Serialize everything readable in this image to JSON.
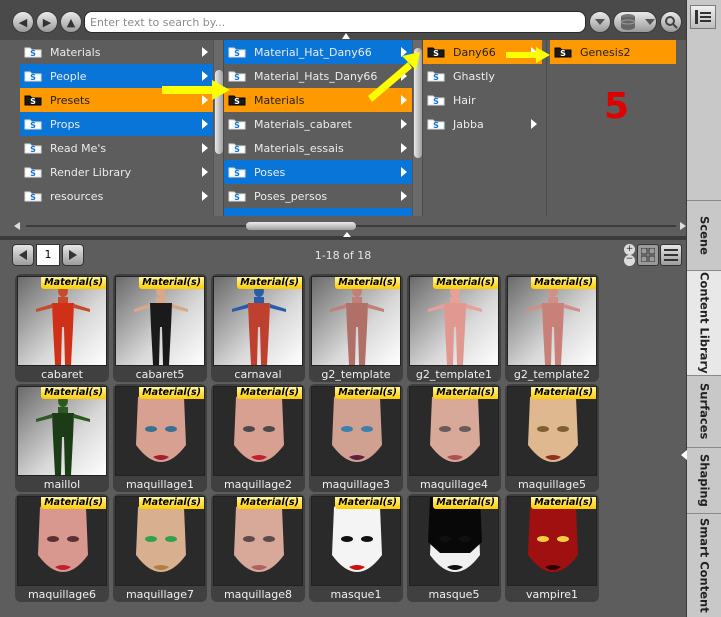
{
  "toolbar": {
    "back_label": "◀",
    "forward_label": "▶",
    "up_label": "▲",
    "search_placeholder": "Enter text to search by..."
  },
  "browser": {
    "column1": [
      {
        "label": "Materials",
        "state": "none"
      },
      {
        "label": "People",
        "state": "blue"
      },
      {
        "label": "Presets",
        "state": "orange"
      },
      {
        "label": "Props",
        "state": "blue"
      },
      {
        "label": "Read Me's",
        "state": "none"
      },
      {
        "label": "Render Library",
        "state": "none"
      },
      {
        "label": "resources",
        "state": "none"
      }
    ],
    "column2": [
      {
        "label": "Material_Hat_Dany66",
        "state": "blue"
      },
      {
        "label": "Material_Hats_Dany66",
        "state": "none"
      },
      {
        "label": "Materials",
        "state": "orange"
      },
      {
        "label": "Materials_cabaret",
        "state": "none"
      },
      {
        "label": "Materials_essais",
        "state": "none"
      },
      {
        "label": "Poses",
        "state": "blue"
      },
      {
        "label": "Poses_persos",
        "state": "none"
      }
    ],
    "column3": [
      {
        "label": "Dany66",
        "state": "orange"
      },
      {
        "label": "Ghastly",
        "state": "none"
      },
      {
        "label": "Hair",
        "state": "none"
      },
      {
        "label": "Jabba",
        "state": "none"
      }
    ],
    "column4": [
      {
        "label": "Genesis2",
        "state": "orange"
      }
    ]
  },
  "annotation_number": "5",
  "pager": {
    "page": "1",
    "count_text": "1-18 of 18"
  },
  "badge_text": "Material(s)",
  "tiles": [
    {
      "caption": "cabaret",
      "kind": "body",
      "skin": "#c84a2c",
      "outfit": "#d03018"
    },
    {
      "caption": "cabaret5",
      "kind": "body",
      "skin": "#d9a888",
      "outfit": "#1a1a1a"
    },
    {
      "caption": "carnaval",
      "kind": "body",
      "skin": "#2a5da8",
      "outfit": "#c04030"
    },
    {
      "caption": "g2_template",
      "kind": "body",
      "skin": "#c08078",
      "outfit": "#b07068"
    },
    {
      "caption": "g2_template1",
      "kind": "body",
      "skin": "#e8a098",
      "outfit": "#e09890"
    },
    {
      "caption": "g2_template2",
      "kind": "body",
      "skin": "#d09088",
      "outfit": "#c88078"
    },
    {
      "caption": "maillol",
      "kind": "body",
      "skin": "#2a5a22",
      "outfit": "#1c3c18"
    },
    {
      "caption": "maquillage1",
      "kind": "face",
      "skin": "#d8a090",
      "lips": "#a02030",
      "eyes": "#3a7090"
    },
    {
      "caption": "maquillage2",
      "kind": "face",
      "skin": "#d8a090",
      "lips": "#c02030",
      "eyes": "#4a4a4a"
    },
    {
      "caption": "maquillage3",
      "kind": "face",
      "skin": "#d0a090",
      "lips": "#602040",
      "eyes": "#3a80b0"
    },
    {
      "caption": "maquillage4",
      "kind": "face",
      "skin": "#d8a898",
      "lips": "#b05050",
      "eyes": "#6a5a5a"
    },
    {
      "caption": "maquillage5",
      "kind": "face",
      "skin": "#e0b890",
      "lips": "#903020",
      "eyes": "#806030"
    },
    {
      "caption": "maquillage6",
      "kind": "face",
      "skin": "#d89890",
      "lips": "#c02030",
      "eyes": "#5a3030"
    },
    {
      "caption": "maquillage7",
      "kind": "face",
      "skin": "#d8b090",
      "lips": "#b08040",
      "eyes": "#30a050"
    },
    {
      "caption": "maquillage8",
      "kind": "face",
      "skin": "#d8a898",
      "lips": "#b06060",
      "eyes": "#5a4a4a"
    },
    {
      "caption": "masque1",
      "kind": "face",
      "skin": "#f4f4f4",
      "lips": "#d01010",
      "eyes": "#101010"
    },
    {
      "caption": "masque5",
      "kind": "face",
      "skin": "#f0f0f0",
      "lips": "#101010",
      "eyes": "#101010",
      "mask": "#080808"
    },
    {
      "caption": "vampire1",
      "kind": "face",
      "skin": "#a01010",
      "lips": "#300000",
      "eyes": "#f0d040"
    }
  ],
  "tabs": [
    "Scene",
    "Content Library",
    "Surfaces",
    "Shaping",
    "Smart Content"
  ],
  "colors": {
    "selected_blue": "#0a75d8",
    "active_orange": "#ff9900",
    "annotation_arrow": "#ffff00",
    "annotation_number": "#e00000"
  }
}
